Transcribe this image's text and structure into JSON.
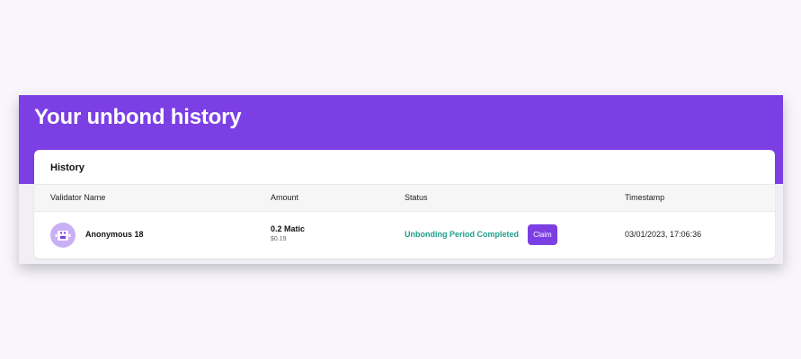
{
  "page": {
    "title": "Your unbond history",
    "accent_color": "#7b3fe4"
  },
  "history": {
    "header": "History",
    "columns": [
      "Validator Name",
      "Amount",
      "Status",
      "Timestamp"
    ],
    "rows": [
      {
        "avatar_icon": "robot-icon",
        "validator_name": "Anonymous 18",
        "amount": "0.2 Matic",
        "amount_usd": "$0.19",
        "status": "Unbonding Period Completed",
        "status_color": "#1f9e8a",
        "action_label": "Claim",
        "timestamp": "03/01/2023, 17:06:36"
      }
    ]
  }
}
